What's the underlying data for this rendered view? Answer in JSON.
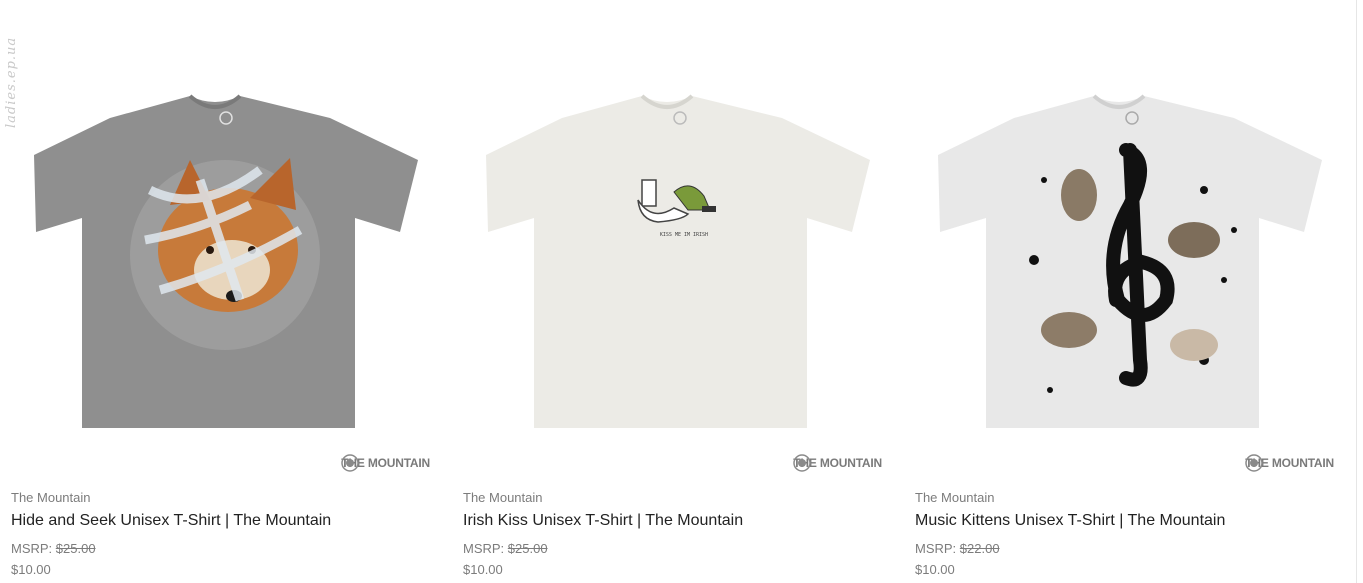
{
  "watermark": "ladies.ep.ua",
  "brand_logo_text": "THE MOUNTAIN",
  "products": [
    {
      "vendor": "The Mountain",
      "title": "Hide and Seek Unisex T-Shirt | The Mountain",
      "msrp_label": "MSRP:",
      "msrp_value": "$25.00",
      "price": "$10.00",
      "shirt_color": "#8f8f8f",
      "graphic": "fox-in-snow"
    },
    {
      "vendor": "The Mountain",
      "title": "Irish Kiss Unisex T-Shirt | The Mountain",
      "msrp_label": "MSRP:",
      "msrp_value": "$25.00",
      "price": "$10.00",
      "shirt_color": "#ecebe6",
      "graphic": "kiss-me-im-irish",
      "graphic_text": "KISS ME IM IRISH"
    },
    {
      "vendor": "The Mountain",
      "title": "Music Kittens Unisex T-Shirt | The Mountain",
      "msrp_label": "MSRP:",
      "msrp_value": "$22.00",
      "price": "$10.00",
      "shirt_color": "#e8e8e8",
      "graphic": "treble-clef-kittens"
    }
  ]
}
